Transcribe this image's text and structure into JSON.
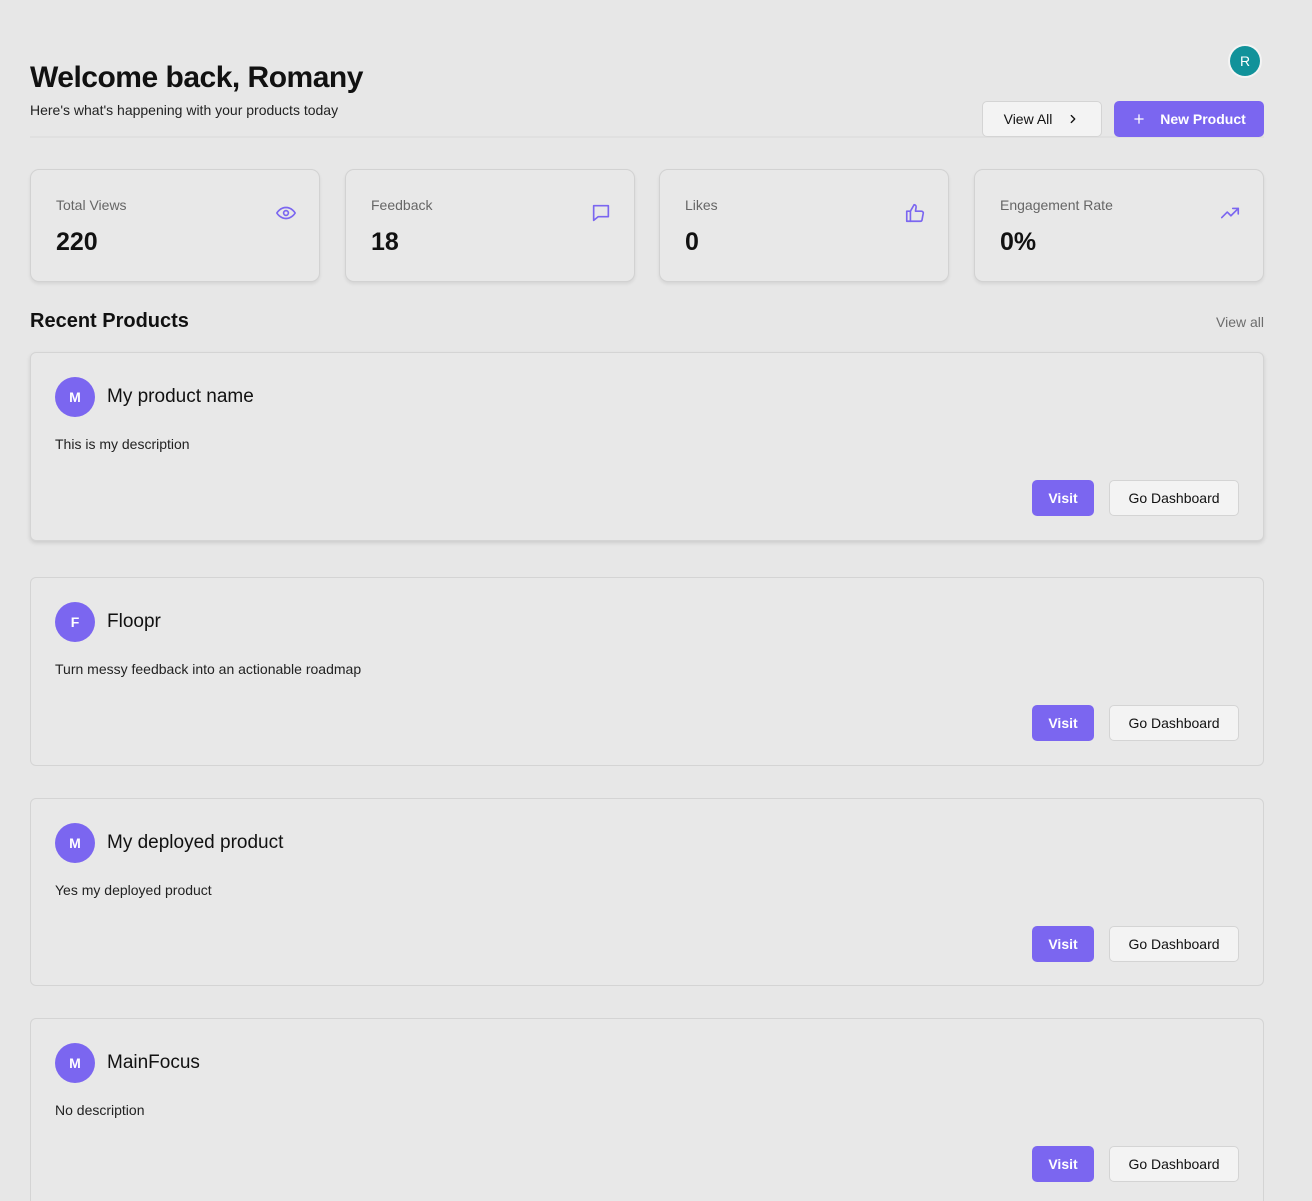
{
  "user": {
    "avatar_initial": "R"
  },
  "header": {
    "title": "Welcome back, Romany",
    "subtitle": "Here's what's happening with your products today",
    "view_all_label": "View All",
    "new_product_label": "New Product"
  },
  "stats": [
    {
      "label": "Total Views",
      "value": "220",
      "icon": "eye-icon"
    },
    {
      "label": "Feedback",
      "value": "18",
      "icon": "message-icon"
    },
    {
      "label": "Likes",
      "value": "0",
      "icon": "thumbs-up-icon"
    },
    {
      "label": "Engagement Rate",
      "value": "0%",
      "icon": "trending-up-icon"
    }
  ],
  "recent": {
    "title": "Recent Products",
    "view_all_label": "View all"
  },
  "products": [
    {
      "initial": "M",
      "name": "My product name",
      "description": "This is my description",
      "visit_label": "Visit",
      "dashboard_label": "Go Dashboard"
    },
    {
      "initial": "F",
      "name": "Floopr",
      "description": "Turn messy feedback into an actionable roadmap",
      "visit_label": "Visit",
      "dashboard_label": "Go Dashboard"
    },
    {
      "initial": "M",
      "name": "My deployed product",
      "description": "Yes my deployed product",
      "visit_label": "Visit",
      "dashboard_label": "Go Dashboard"
    },
    {
      "initial": "M",
      "name": "MainFocus",
      "description": "No description",
      "visit_label": "Visit",
      "dashboard_label": "Go Dashboard"
    }
  ],
  "colors": {
    "accent": "#7b66f0",
    "avatar_top": "#11929a",
    "background": "#e7e7e7"
  }
}
